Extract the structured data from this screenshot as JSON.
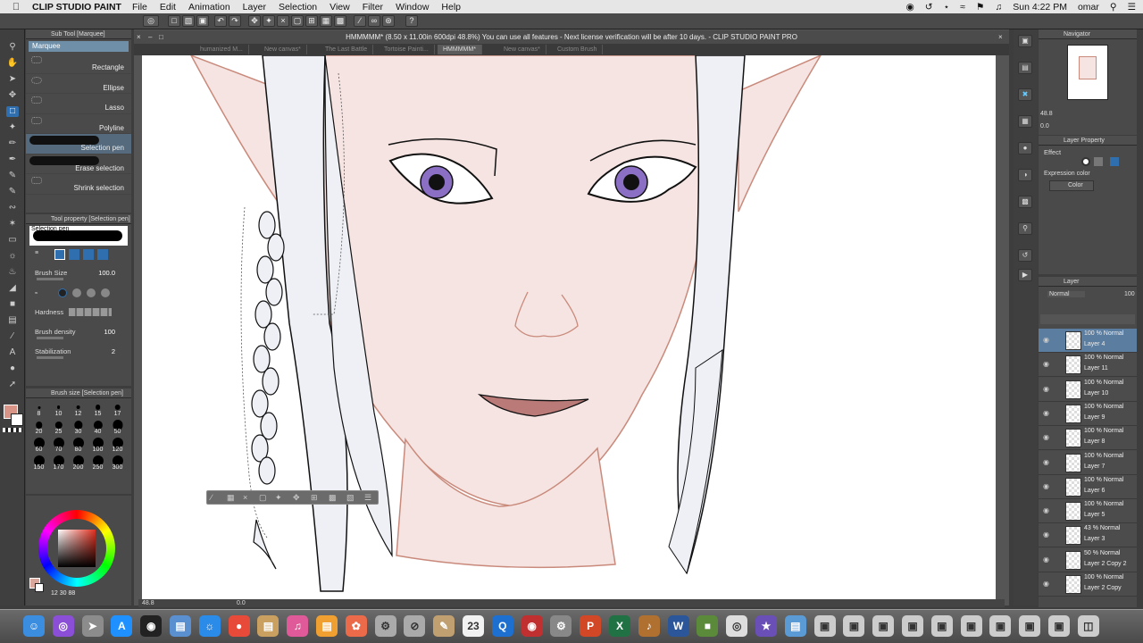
{
  "menubar": {
    "app_name": "CLIP STUDIO PAINT",
    "menus": [
      "File",
      "Edit",
      "Animation",
      "Layer",
      "Selection",
      "View",
      "Filter",
      "Window",
      "Help"
    ],
    "clock": "Sun 4:22 PM",
    "user": "omar"
  },
  "window": {
    "title": "HMMMMM* (8.50 x 11.00in 600dpi 48.8%)  You can use all features - Next license verification will be after 10 days. - CLIP STUDIO PAINT PRO"
  },
  "doc_tabs": [
    "humanized M...",
    "New canvas*",
    "The Last Battle",
    "Tortoise Painti...",
    "HMMMMM*",
    "New canvas*",
    "Custom Brush"
  ],
  "subtool": {
    "header": "Sub Tool [Marquee]",
    "group": "Marquee",
    "items": [
      "Rectangle",
      "Ellipse",
      "Lasso",
      "Polyline",
      "Selection pen",
      "Erase selection",
      "Shrink selection"
    ]
  },
  "tool_property": {
    "header": "Tool property [Selection pen]",
    "preview_label": "Selection pen",
    "brush_size_label": "Brush Size",
    "brush_size": "100.0",
    "hardness_label": "Hardness",
    "density_label": "Brush density",
    "density": "100",
    "stabilization_label": "Stabilization",
    "stabilization": "2"
  },
  "brush_size_panel": {
    "header": "Brush size [Selection pen]",
    "sizes": [
      "8",
      "10",
      "12",
      "15",
      "17",
      "20",
      "25",
      "30",
      "40",
      "50",
      "60",
      "70",
      "80",
      "100",
      "120",
      "150",
      "170",
      "200",
      "250",
      "300"
    ]
  },
  "color": {
    "main": "#d9a79b",
    "sub": "#ffffff",
    "readout": "12   30   88"
  },
  "canvas_status": {
    "zoom": "48.8",
    "angle": "0.0"
  },
  "navigator": {
    "header": "Navigator",
    "zoom": "48.8",
    "angle": "0.0"
  },
  "layer_property": {
    "header": "Layer Property",
    "effect_label": "Effect",
    "expression_label": "Expression color",
    "expression_value": "Color"
  },
  "layer_panel": {
    "header": "Layer",
    "blend": "Normal",
    "opacity": "100",
    "layers": [
      {
        "mode": "100 % Normal",
        "name": "Layer 4"
      },
      {
        "mode": "100 % Normal",
        "name": "Layer 11"
      },
      {
        "mode": "100 % Normal",
        "name": "Layer 10"
      },
      {
        "mode": "100 % Normal",
        "name": "Layer 9"
      },
      {
        "mode": "100 % Normal",
        "name": "Layer 8"
      },
      {
        "mode": "100 % Normal",
        "name": "Layer 7"
      },
      {
        "mode": "100 % Normal",
        "name": "Layer 6"
      },
      {
        "mode": "100 % Normal",
        "name": "Layer 5"
      },
      {
        "mode": "43 % Normal",
        "name": "Layer 3"
      },
      {
        "mode": "50 % Normal",
        "name": "Layer 2 Copy 2"
      },
      {
        "mode": "100 % Normal",
        "name": "Layer 2 Copy"
      }
    ]
  },
  "colors": {
    "skin": "#f5e4e1",
    "skin_line": "#c98a7c",
    "hair": "#eef0f6",
    "iris": "#8a6fc4",
    "lip": "#b97a78",
    "accent": "#2f6fb0"
  }
}
